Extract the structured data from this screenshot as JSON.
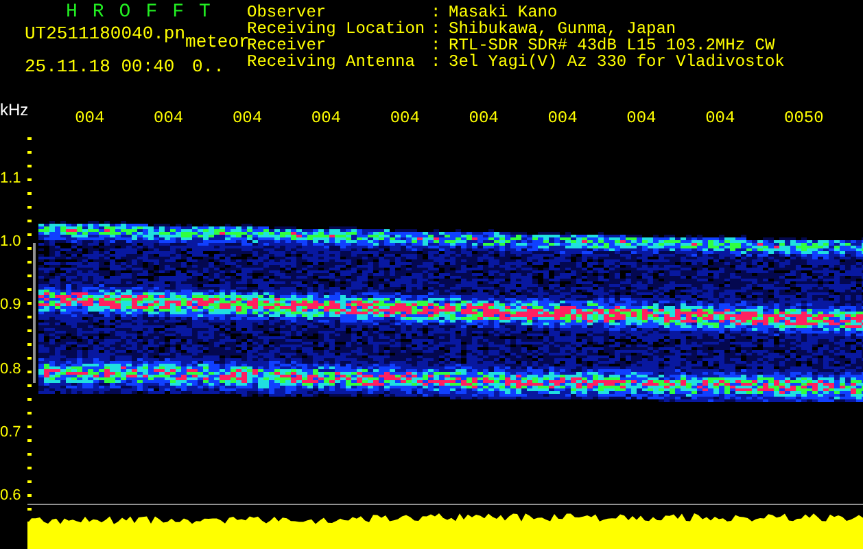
{
  "app_title": "HROFFT",
  "file": {
    "name": "UT2511180040.pn",
    "tag": "meteor",
    "datetime": "25.11.18 00:40",
    "value": "0.."
  },
  "info": [
    {
      "label": "Observer",
      "separator": ":",
      "value": "Masaki Kano"
    },
    {
      "label": "Receiving Location",
      "separator": ":",
      "value": "Shibukawa, Gunma, Japan"
    },
    {
      "label": "Receiver",
      "separator": ":",
      "value": "RTL-SDR SDR# 43dB L15 103.2MHz CW"
    },
    {
      "label": "Receiving Antenna",
      "separator": ":",
      "value": "3el Yagi(V) Az 330 for Vladivostok"
    }
  ],
  "time_axis": {
    "unit": "kHz",
    "labels": [
      "004",
      "004",
      "004",
      "004",
      "004",
      "004",
      "004",
      "004",
      "004",
      "0050"
    ]
  },
  "frequency_axis": {
    "labels": [
      "1.1",
      "1.0",
      "0.9",
      "0.8",
      "0.7",
      "0.6"
    ]
  }
}
